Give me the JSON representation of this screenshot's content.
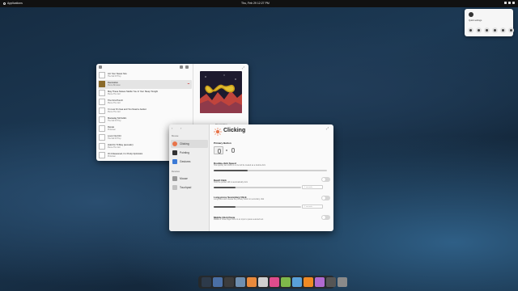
{
  "topbar": {
    "activities": "Applications",
    "clock": "Thu, Feb 29    12:27 PM"
  },
  "quick_settings": {
    "label": "Quick settings",
    "icons": [
      "wifi-icon",
      "bluetooth-icon",
      "dark-mode-icon",
      "power-profile-icon",
      "night-light-icon",
      "airplane-icon"
    ]
  },
  "music": {
    "tracks": [
      {
        "title": "Act Your Sweet Sire",
        "sub": "The Fall Of Troy",
        "selected": false
      },
      {
        "title": "Decoration",
        "sub": "Pierce Brosnan",
        "selected": true
      },
      {
        "title": "May These Noises Startle You In Your Sleep Tonight",
        "sub": "Pierce The Veil",
        "selected": false
      },
      {
        "title": "The First Punch",
        "sub": "Pierce The Veil",
        "selected": false
      },
      {
        "title": "I'm Low On Gas and You Need a Jacket",
        "sub": "Pierce The Veil",
        "selected": false
      },
      {
        "title": "Macaulay McCulkin",
        "sub": "The Fall Of Troy",
        "selected": false
      },
      {
        "title": "Rerate",
        "sub": "Protomen",
        "selected": false
      },
      {
        "title": "Lover Out Dirt",
        "sub": "The Fall Of Troy",
        "selected": false
      },
      {
        "title": "Hold On Til May (acoustic)",
        "sub": "Pierce The Veil",
        "selected": false
      },
      {
        "title": "Ol 4 Reasoned, I'm Pretty Optimistic",
        "sub": "Protomen",
        "selected": false
      }
    ],
    "now_playing": "Decoration"
  },
  "settings": {
    "header": "Clicking",
    "sidebar": {
      "section_top": "Mouse",
      "items": [
        {
          "label": "Clicking",
          "active": true,
          "color": "#e8744a"
        },
        {
          "label": "Pointing",
          "active": false,
          "color": "#333333"
        },
        {
          "label": "Gestures",
          "active": false,
          "color": "#3b7ad6"
        }
      ],
      "section_devices": "Devices",
      "devices": [
        {
          "label": "Mouse",
          "color": "#9a9a9a"
        },
        {
          "label": "Touchpad",
          "color": "#c2c2c2"
        }
      ]
    },
    "primary_button": {
      "label": "Primary Button"
    },
    "double_click": {
      "label": "Double-click Speed",
      "sub": "How quickly two clicks in a row will be treated as a double-click",
      "level": 0.3
    },
    "dwell_click": {
      "label": "Dwell Click",
      "sub": "Hold the pointer still to automatically click",
      "box": "1 seconds",
      "level": 0.25
    },
    "long_press": {
      "label": "Long-press Secondary Click",
      "sub": "Long-press and release the primary button to secondary click",
      "box": "1 seconds",
      "level": 0.25
    },
    "middle_paste": {
      "label": "Middle Click Paste",
      "sub": "Middle or three-finger click on an input to paste selected text"
    }
  },
  "dock": {
    "apps": [
      {
        "name": "terminal-icon",
        "color": "#2d3a4a"
      },
      {
        "name": "monitor-icon",
        "color": "#4a6fa5"
      },
      {
        "name": "code-icon",
        "color": "#3c3c3c"
      },
      {
        "name": "files-icon",
        "color": "#6f8fb0"
      },
      {
        "name": "store-icon",
        "color": "#e98a3c"
      },
      {
        "name": "disk-icon",
        "color": "#d0d0d0"
      },
      {
        "name": "tasks-icon",
        "color": "#e04c8c"
      },
      {
        "name": "notes-icon",
        "color": "#7fb84a"
      },
      {
        "name": "photos-icon",
        "color": "#5aa0d8"
      },
      {
        "name": "music-icon",
        "color": "#f08a24"
      },
      {
        "name": "web-icon",
        "color": "#b06ad0"
      },
      {
        "name": "camera-icon",
        "color": "#555555"
      },
      {
        "name": "settings-icon",
        "color": "#8a8a8a"
      }
    ]
  }
}
